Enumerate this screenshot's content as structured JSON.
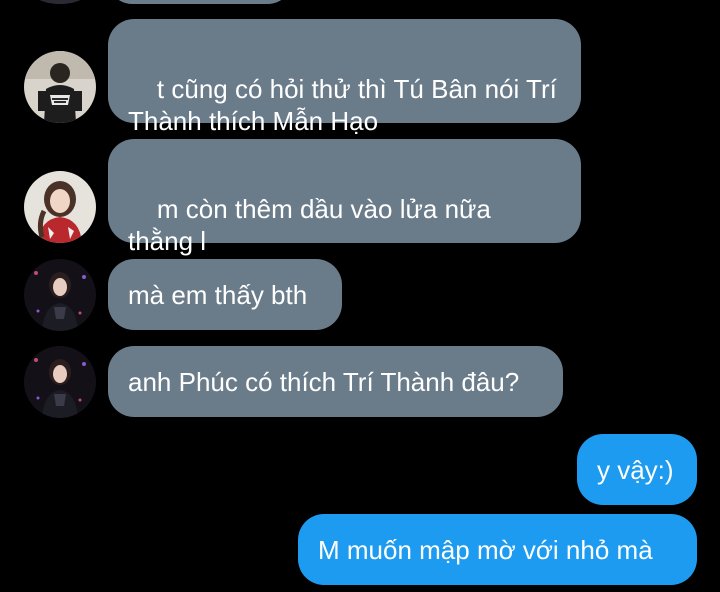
{
  "messages": [
    {
      "side": "incoming",
      "avatar": "avatar-boy",
      "text": "t cũng có hỏi thử thì Tú Bân nói Trí\nThành thích Mẫn Hạo"
    },
    {
      "side": "incoming",
      "avatar": "avatar-girl-red",
      "text": "m còn thêm dầu vào lửa nữa\nthằng l"
    },
    {
      "side": "incoming",
      "avatar": "avatar-girl-dark",
      "text": "mà em thấy bth"
    },
    {
      "side": "incoming",
      "avatar": "avatar-girl-dark",
      "text": "anh Phúc có thích Trí Thành đâu?"
    },
    {
      "side": "outgoing",
      "text": "y vậy:)"
    },
    {
      "side": "outgoing",
      "text": "M muốn mập mờ với nhỏ mà"
    }
  ],
  "colors": {
    "background": "#000000",
    "incoming_bubble": "#6a7b8a",
    "outgoing_bubble": "#1d9bf0",
    "text": "#ffffff"
  }
}
